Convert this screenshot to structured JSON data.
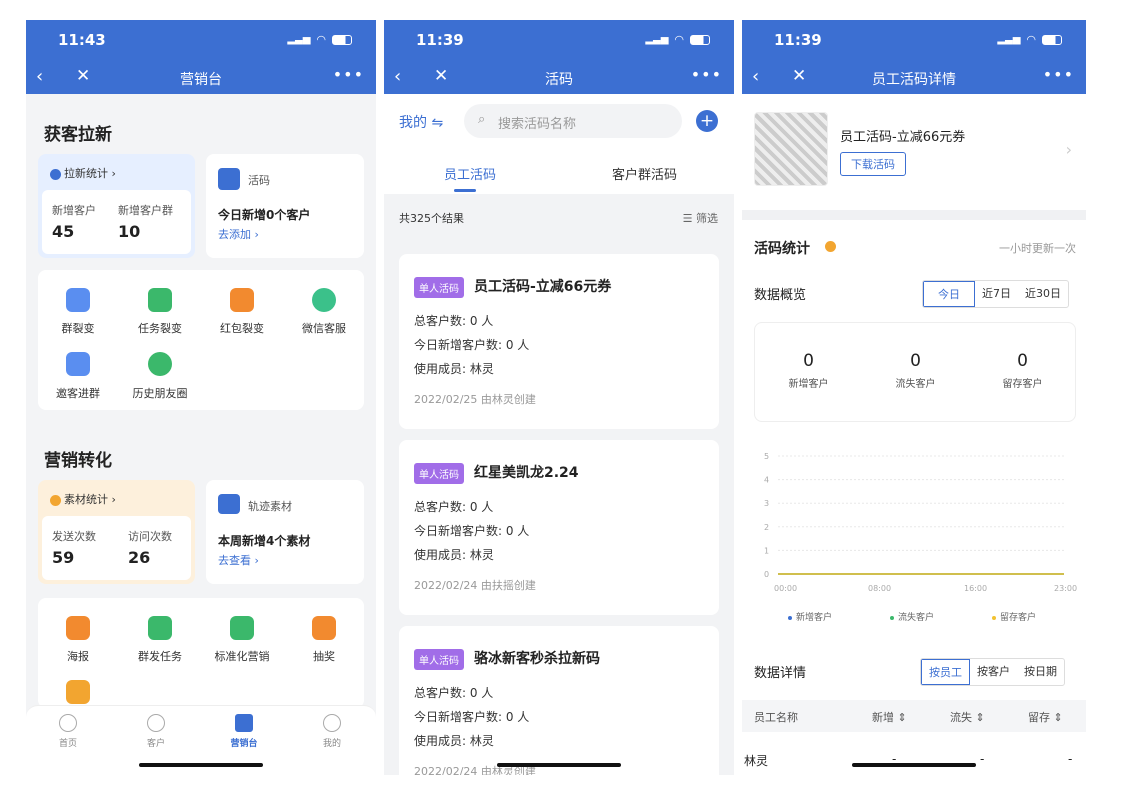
{
  "s1": {
    "time": "11:43",
    "title": "营销台",
    "sec1": "获客拉新",
    "stat1": {
      "title": "拉新统计",
      "l1": "新增客户",
      "v1": "45",
      "l2": "新增客户群",
      "v2": "10"
    },
    "code": {
      "title": "活码",
      "text": "今日新增0个客户",
      "link": "去添加"
    },
    "grid1": [
      "群裂变",
      "任务裂变",
      "红包裂变",
      "微信客服",
      "邀客进群",
      "历史朋友圈"
    ],
    "sec2": "营销转化",
    "stat2": {
      "title": "素材统计",
      "l1": "发送次数",
      "v1": "59",
      "l2": "访问次数",
      "v2": "26"
    },
    "track": {
      "title": "轨迹素材",
      "text": "本周新增4个素材",
      "link": "去查看"
    },
    "grid2": [
      "海报",
      "群发任务",
      "标准化营销",
      "抽奖"
    ],
    "tabs": [
      "首页",
      "客户",
      "营销台",
      "我的"
    ]
  },
  "s2": {
    "time": "11:39",
    "title": "活码",
    "mine": "我的",
    "search_ph": "搜索活码名称",
    "tab1": "员工活码",
    "tab2": "客户群活码",
    "total": "共325个结果",
    "filter": "筛选",
    "items": [
      {
        "tag": "单人活码",
        "name": "员工活码-立减66元券",
        "l1": "总客户数: 0 人",
        "l2": "今日新增客户数: 0 人",
        "l3": "使用成员: 林灵",
        "date": "2022/02/25   由林灵创建"
      },
      {
        "tag": "单人活码",
        "name": "红星美凯龙2.24",
        "l1": "总客户数: 0 人",
        "l2": "今日新增客户数: 0 人",
        "l3": "使用成员: 林灵",
        "date": "2022/02/24   由扶摇创建"
      },
      {
        "tag": "单人活码",
        "name": "骆冰新客秒杀拉新码",
        "l1": "总客户数: 0 人",
        "l2": "今日新增客户数: 0 人",
        "l3": "使用成员: 林灵",
        "date": "2022/02/24   由林灵创建"
      }
    ]
  },
  "s3": {
    "time": "11:39",
    "title": "员工活码详情",
    "name": "员工活码-立减66元券",
    "download": "下载活码",
    "stat_title": "活码统计",
    "update": "一小时更新一次",
    "overview": "数据概览",
    "seg1": [
      "今日",
      "近7日",
      "近30日"
    ],
    "kpi": [
      {
        "v": "0",
        "l": "新增客户"
      },
      {
        "v": "0",
        "l": "流失客户"
      },
      {
        "v": "0",
        "l": "留存客户"
      }
    ],
    "detail": "数据详情",
    "seg2": [
      "按员工",
      "按客户",
      "按日期"
    ],
    "cols": [
      "员工名称",
      "新增",
      "流失",
      "留存"
    ],
    "row": [
      "林灵",
      "-",
      "-",
      "-"
    ]
  },
  "chart_data": {
    "type": "line",
    "x": [
      "00:00",
      "08:00",
      "16:00",
      "23:00"
    ],
    "ylim": [
      0,
      5
    ],
    "yticks": [
      0,
      1,
      2,
      3,
      4,
      5
    ],
    "series": [
      {
        "name": "新增客户",
        "values": [
          0,
          0,
          0,
          0
        ],
        "color": "#3c6fd2"
      },
      {
        "name": "流失客户",
        "values": [
          0,
          0,
          0,
          0
        ],
        "color": "#3bb86b"
      },
      {
        "name": "留存客户",
        "values": [
          0,
          0,
          0,
          0
        ],
        "color": "#f2c230"
      }
    ]
  }
}
